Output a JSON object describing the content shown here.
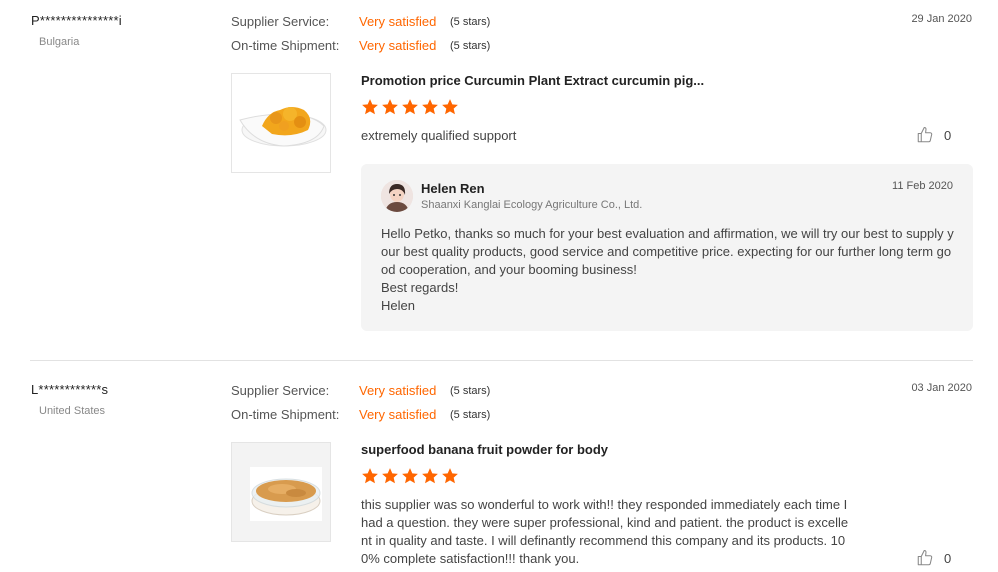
{
  "colors": {
    "accent": "#ff6600",
    "star": "#ff6600",
    "reply_bg": "#f4f4f4"
  },
  "reviews": [
    {
      "buyer": "P***************i",
      "country": "Bulgaria",
      "date": "29 Jan 2020",
      "ratings": [
        {
          "label": "Supplier Service:",
          "value": "Very satisfied",
          "stars_text": "(5 stars)"
        },
        {
          "label": "On-time Shipment:",
          "value": "Very satisfied",
          "stars_text": "(5 stars)"
        }
      ],
      "product_image_icon": "curcumin-powder-dish",
      "product_title": "Promotion price Curcumin Plant Extract curcumin pig...",
      "stars": 5,
      "text": "extremely qualified support",
      "likes": "0",
      "reply": {
        "name": "Helen Ren",
        "company": "Shaanxi Kanglai Ecology Agriculture Co., Ltd.",
        "date": "11 Feb 2020",
        "lines": [
          "Hello Petko, thanks so much for your best evaluation and affirmation, we will try our best to supply your best quality products, good service and competitive price. expecting for our further long term good cooperation, and your booming business!",
          "Best regards!",
          "Helen"
        ]
      }
    },
    {
      "buyer": "L************s",
      "country": "United States",
      "date": "03 Jan 2020",
      "ratings": [
        {
          "label": "Supplier Service:",
          "value": "Very satisfied",
          "stars_text": "(5 stars)"
        },
        {
          "label": "On-time Shipment:",
          "value": "Very satisfied",
          "stars_text": "(5 stars)"
        }
      ],
      "product_image_icon": "banana-powder-dish",
      "product_title": "superfood banana fruit powder for body",
      "stars": 5,
      "text": "this supplier was so wonderful to work with!! they responded immediately each time I had a question. they were super professional, kind and patient.  the product is excellent in quality and taste.  I will definantly recommend this company and its products.  100% complete satisfaction!!! thank you.",
      "likes": "0"
    }
  ]
}
